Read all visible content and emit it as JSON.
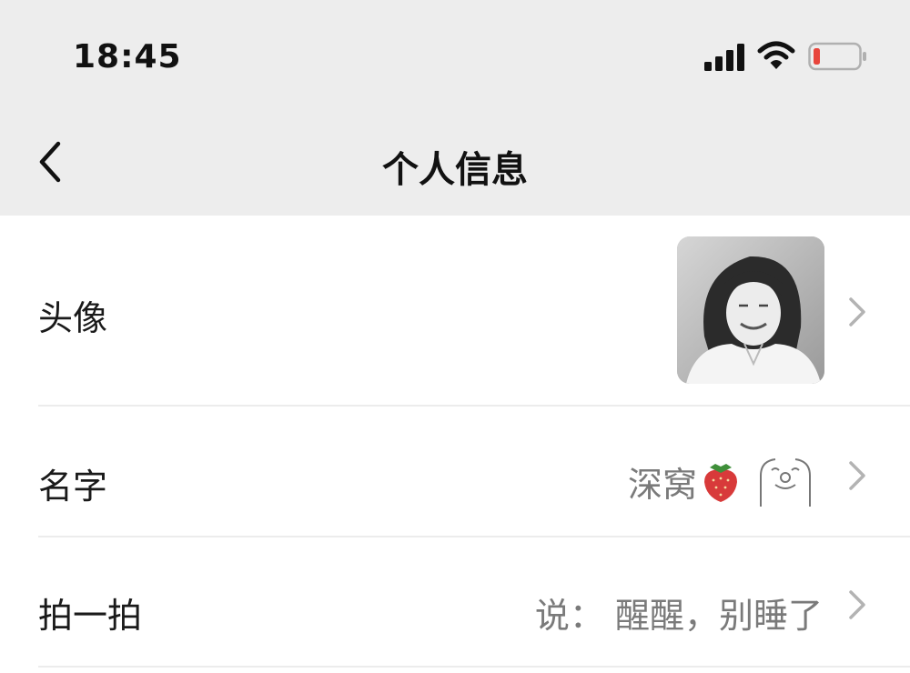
{
  "status_bar": {
    "time": "18:45",
    "icons": [
      "signal-icon",
      "wifi-icon",
      "battery-icon"
    ],
    "battery_color": "#e8453c"
  },
  "nav": {
    "title": "个人信息",
    "back_icon": "chevron-left-icon"
  },
  "rows": [
    {
      "label": "头像",
      "value_type": "avatar-image"
    },
    {
      "label": "名字",
      "value": "深窝",
      "decorations": [
        "strawberry-icon",
        "kaomoji-icon"
      ]
    },
    {
      "label": "拍一拍",
      "value": "说：  醒醒，别睡了"
    }
  ],
  "colors": {
    "header_bg": "#ededed",
    "list_bg": "#ffffff",
    "value_text": "#7a7a7a",
    "chevron": "#b3b3b3"
  }
}
